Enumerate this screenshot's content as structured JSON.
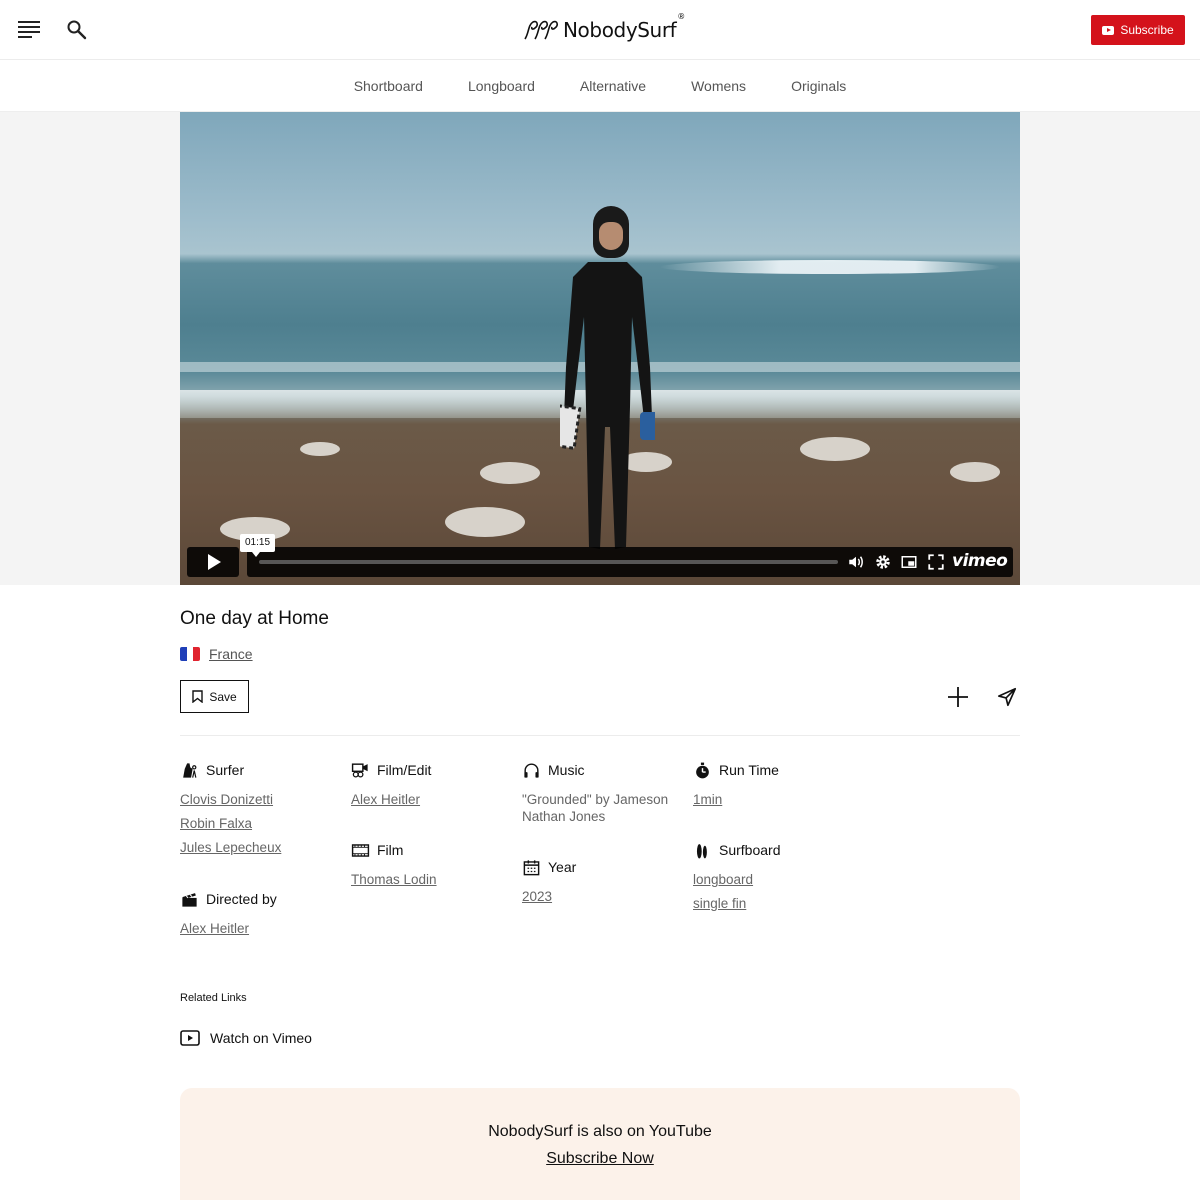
{
  "header": {
    "logo_text": "NobodySurf",
    "logo_reg": "®",
    "subscribe_label": "Subscribe"
  },
  "nav": {
    "items": [
      "Shortboard",
      "Longboard",
      "Alternative",
      "Womens",
      "Originals"
    ]
  },
  "player": {
    "time_tooltip": "01:15",
    "brand": "vimeo"
  },
  "video": {
    "title": "One day at Home",
    "country": "France",
    "save_label": "Save"
  },
  "credits": {
    "surfer": {
      "label": "Surfer",
      "names": [
        "Clovis Donizetti",
        "Robin Falxa",
        "Jules Lepecheux"
      ]
    },
    "directed": {
      "label": "Directed by",
      "names": [
        "Alex Heitler"
      ]
    },
    "film_edit": {
      "label": "Film/Edit",
      "names": [
        "Alex Heitler"
      ]
    },
    "film": {
      "label": "Film",
      "names": [
        "Thomas Lodin"
      ]
    },
    "music": {
      "label": "Music",
      "text": "\"Grounded\" by Jameson Nathan Jones"
    },
    "year": {
      "label": "Year",
      "names": [
        "2023"
      ]
    },
    "runtime": {
      "label": "Run Time",
      "names": [
        "1min"
      ]
    },
    "surfboard": {
      "label": "Surfboard",
      "names": [
        "longboard",
        "single fin"
      ]
    }
  },
  "related": {
    "label": "Related Links",
    "watch_label": "Watch on Vimeo"
  },
  "banner": {
    "text": "NobodySurf is also on YouTube",
    "link": "Subscribe Now"
  },
  "colors": {
    "subscribe_red": "#d4121b",
    "banner_bg": "#fcf2ea"
  }
}
